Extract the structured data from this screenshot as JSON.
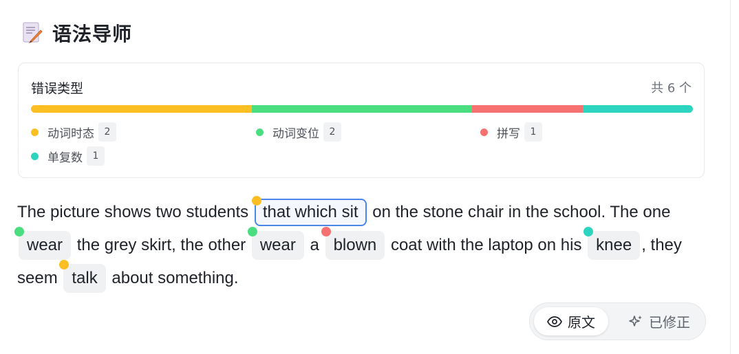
{
  "header": {
    "title": "语法导师",
    "icon": "memo-pencil-icon"
  },
  "error_summary": {
    "heading": "错误类型",
    "total": "共 6 个",
    "categories": [
      {
        "label": "动词时态",
        "count": "2",
        "color": "#fbbf24"
      },
      {
        "label": "动词变位",
        "count": "2",
        "color": "#4ade80"
      },
      {
        "label": "拼写",
        "count": "1",
        "color": "#f87171"
      },
      {
        "label": "单复数",
        "count": "1",
        "color": "#2dd4bf"
      }
    ]
  },
  "passage": {
    "t1": "The picture shows two students",
    "e1": "that which sit",
    "t2": "on the stone chair in the school. The one",
    "e2": "wear",
    "t3": "the grey skirt, the other",
    "e3": "wear",
    "t4": "a",
    "e4": "blown",
    "t5": "coat with the laptop on his",
    "e5": "knee",
    "t6": ", they seem",
    "e6": "talk",
    "t7": "about something."
  },
  "view_toggle": {
    "original_label": "原文",
    "corrected_label": "已修正",
    "selected": "原文",
    "original_icon": "eye-icon",
    "corrected_icon": "sparkle-icon"
  }
}
